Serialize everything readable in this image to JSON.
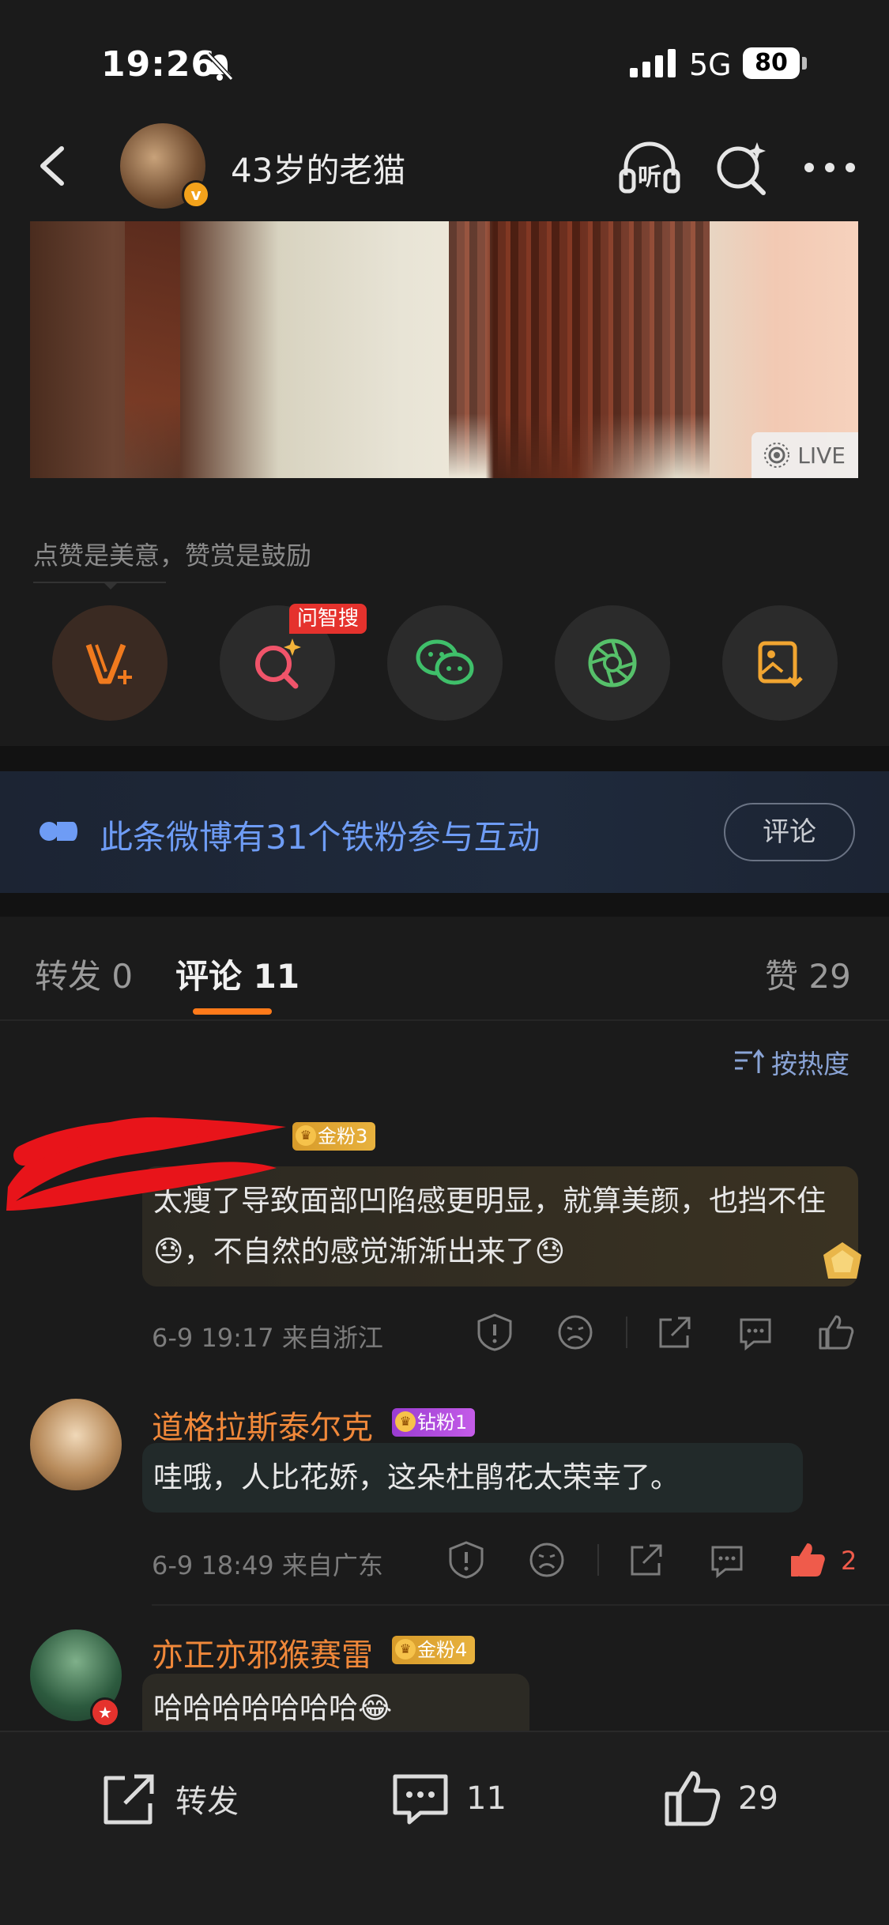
{
  "status_bar": {
    "time": "19:26",
    "network": "5G",
    "battery": "80"
  },
  "header": {
    "title": "43岁的老猫"
  },
  "post": {
    "live_label": "LIVE",
    "reward_text": "点赞是美意，赞赏是鼓励",
    "ai_search_tag": "问智搜"
  },
  "fans_banner": {
    "text": "此条微博有31个铁粉参与互动",
    "button": "评论"
  },
  "tabs": {
    "repost_label": "转发 0",
    "comment_label": "评论 11",
    "like_label": "赞 29"
  },
  "sort_label": "按热度",
  "comments": [
    {
      "badge": "金粉3",
      "text": "太瘦了导致面部凹陷感更明显，就算美颜，也挡不住😓，不自然的感觉渐渐出来了😓",
      "meta": "6-9 19:17  来自浙江"
    },
    {
      "name": "道格拉斯泰尔克",
      "badge": "钻粉1",
      "text": "哇哦，人比花娇，这朵杜鹃花太荣幸了。",
      "meta": "6-9 18:49  来自广东",
      "likes": "2"
    },
    {
      "name": "亦正亦邪猴赛雷",
      "badge": "金粉4",
      "text": "哈哈哈哈哈哈哈😂"
    }
  ],
  "bottom_bar": {
    "repost": "转发",
    "comments": "11",
    "likes": "29"
  },
  "colors": {
    "accent_orange": "#ff7a1a",
    "username_orange": "#f0883a",
    "link_blue": "#6e9cf5",
    "like_red": "#ef5b4b"
  }
}
